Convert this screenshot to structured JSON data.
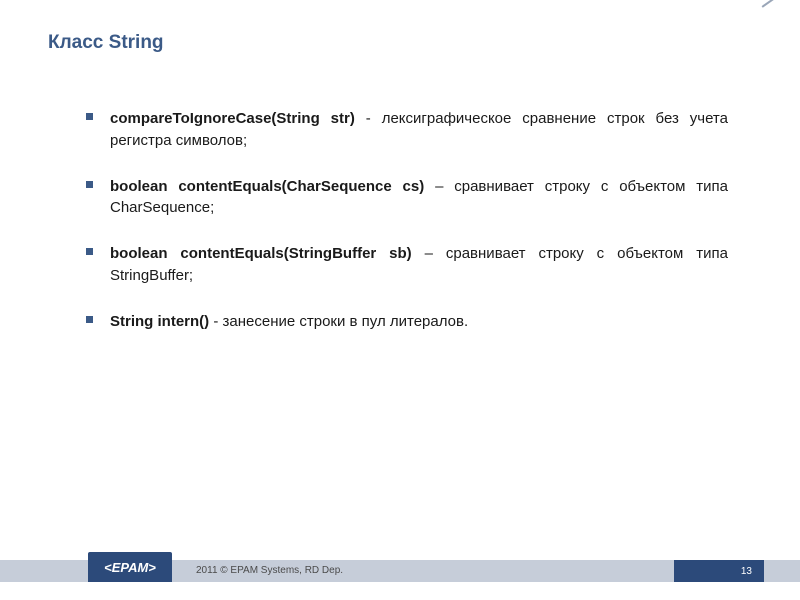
{
  "title": "Класс String",
  "bullets": [
    {
      "sig": "compareToIgnoreCase(String str)",
      "sep": " - ",
      "desc": "лексиграфическое сравнение строк без учета регистра символов;"
    },
    {
      "sig": "boolean contentEquals(CharSequence cs)",
      "sep": " – ",
      "desc": "сравнивает строку с объектом типа CharSequence;"
    },
    {
      "sig": "boolean contentEquals(StringBuffer sb)",
      "sep": " – ",
      "desc": "сравнивает строку с объектом типа StringBuffer;"
    },
    {
      "sig": "String intern()",
      "sep": " - ",
      "desc": "занесение строки в пул литералов."
    }
  ],
  "footer": {
    "logo": "<EPAM>",
    "copyright": "2011 © EPAM Systems, RD Dep.",
    "page": "13"
  }
}
